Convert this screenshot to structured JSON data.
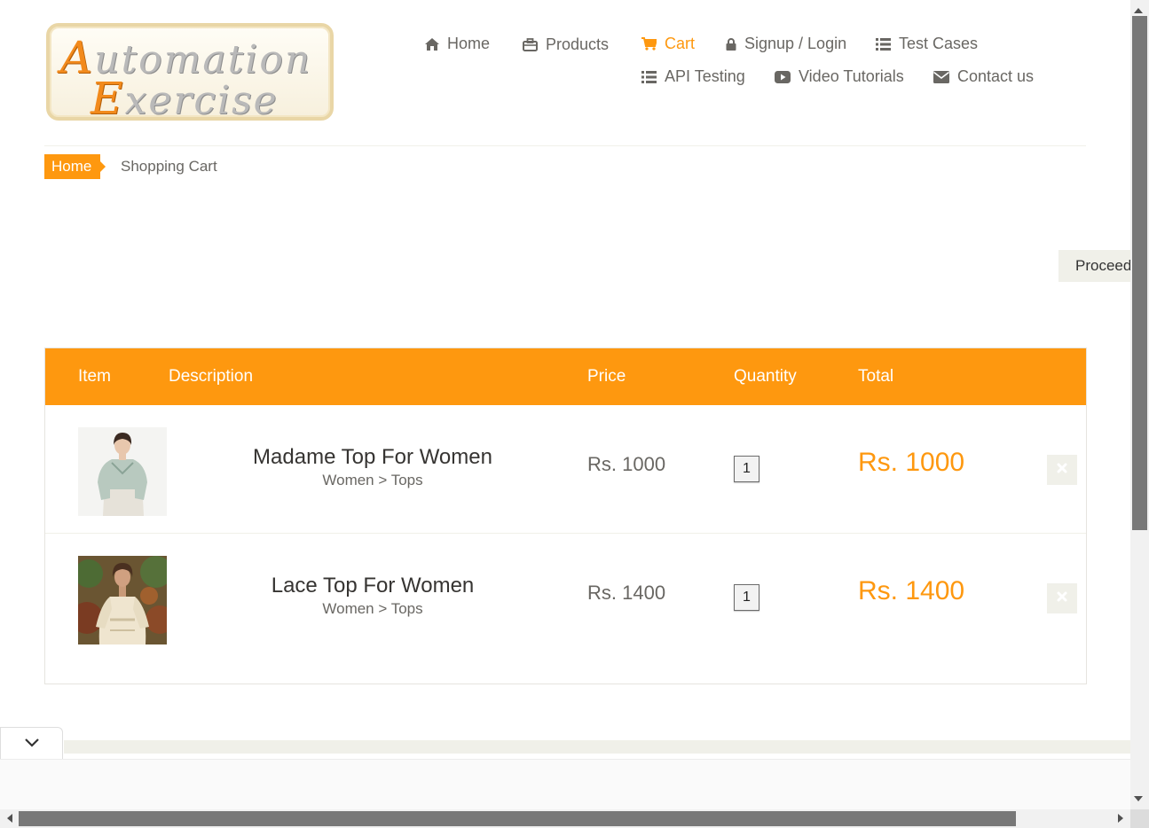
{
  "logo": {
    "line1_cap": "A",
    "line1_rest": "utomation",
    "line2_cap": "E",
    "line2_rest": "xercise"
  },
  "nav": {
    "items": [
      {
        "label": "Home",
        "icon": "home-icon"
      },
      {
        "label": "Products",
        "icon": "briefcase-icon"
      },
      {
        "label": "Cart",
        "icon": "shopping-cart-icon",
        "active": true
      },
      {
        "label": "Signup / Login",
        "icon": "lock-icon"
      },
      {
        "label": "Test Cases",
        "icon": "list-icon"
      },
      {
        "label": "API Testing",
        "icon": "list-icon"
      },
      {
        "label": "Video Tutorials",
        "icon": "youtube-play-icon"
      },
      {
        "label": "Contact us",
        "icon": "envelope-icon"
      }
    ]
  },
  "breadcrumb": {
    "home": "Home",
    "current": "Shopping Cart"
  },
  "proceed_button": "Proceed To Checkout",
  "cart": {
    "headers": {
      "item": "Item",
      "description": "Description",
      "price": "Price",
      "quantity": "Quantity",
      "total": "Total"
    },
    "rows": [
      {
        "name": "Madame Top For Women",
        "category": "Women > Tops",
        "price": "Rs. 1000",
        "quantity": "1",
        "total": "Rs. 1000",
        "image": "woman-in-floral-shirt-photo"
      },
      {
        "name": "Lace Top For Women",
        "category": "Women > Tops",
        "price": "Rs. 1400",
        "quantity": "1",
        "total": "Rs. 1400",
        "image": "woman-in-lace-top-photo"
      }
    ]
  },
  "colors": {
    "accent": "#fe980f",
    "text": "#696763",
    "light_bg": "#f0f0e9"
  }
}
